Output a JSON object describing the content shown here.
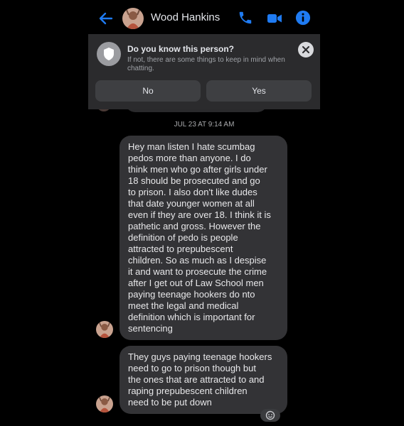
{
  "header": {
    "contact_name": "Wood Hankins",
    "accent_color": "#1f7bf2"
  },
  "banner": {
    "title": "Do you know this person?",
    "description": "If not, there are some things to keep in mind when chatting.",
    "no_label": "No",
    "yes_label": "Yes"
  },
  "conversation": {
    "timestamp": "JUL 23 AT 9:14 AM",
    "messages": [
      {
        "text": "Hey man listen I hate scumbag\npedos more than anyone. I do\nthink men who go after girls under\n18 should be prosecuted and go\nto prison. I also don't like dudes\nthat date younger women at all\neven if they are over 18. I think it is\npathetic and gross. However the\ndefinition of pedo is people\nattracted to prepubescent\nchildren. So as much as I despise\nit and want to prosecute the crime\nafter I get out of Law School men\npaying teenage hookers do nto\nmeet the legal and medical\ndefinition which is important for\nsentencing"
      },
      {
        "text": "They guys paying teenage hookers\nneed to go to prison though but\nthe ones that are attracted to and\nraping prepubescent children\nneed to be put down"
      }
    ]
  }
}
